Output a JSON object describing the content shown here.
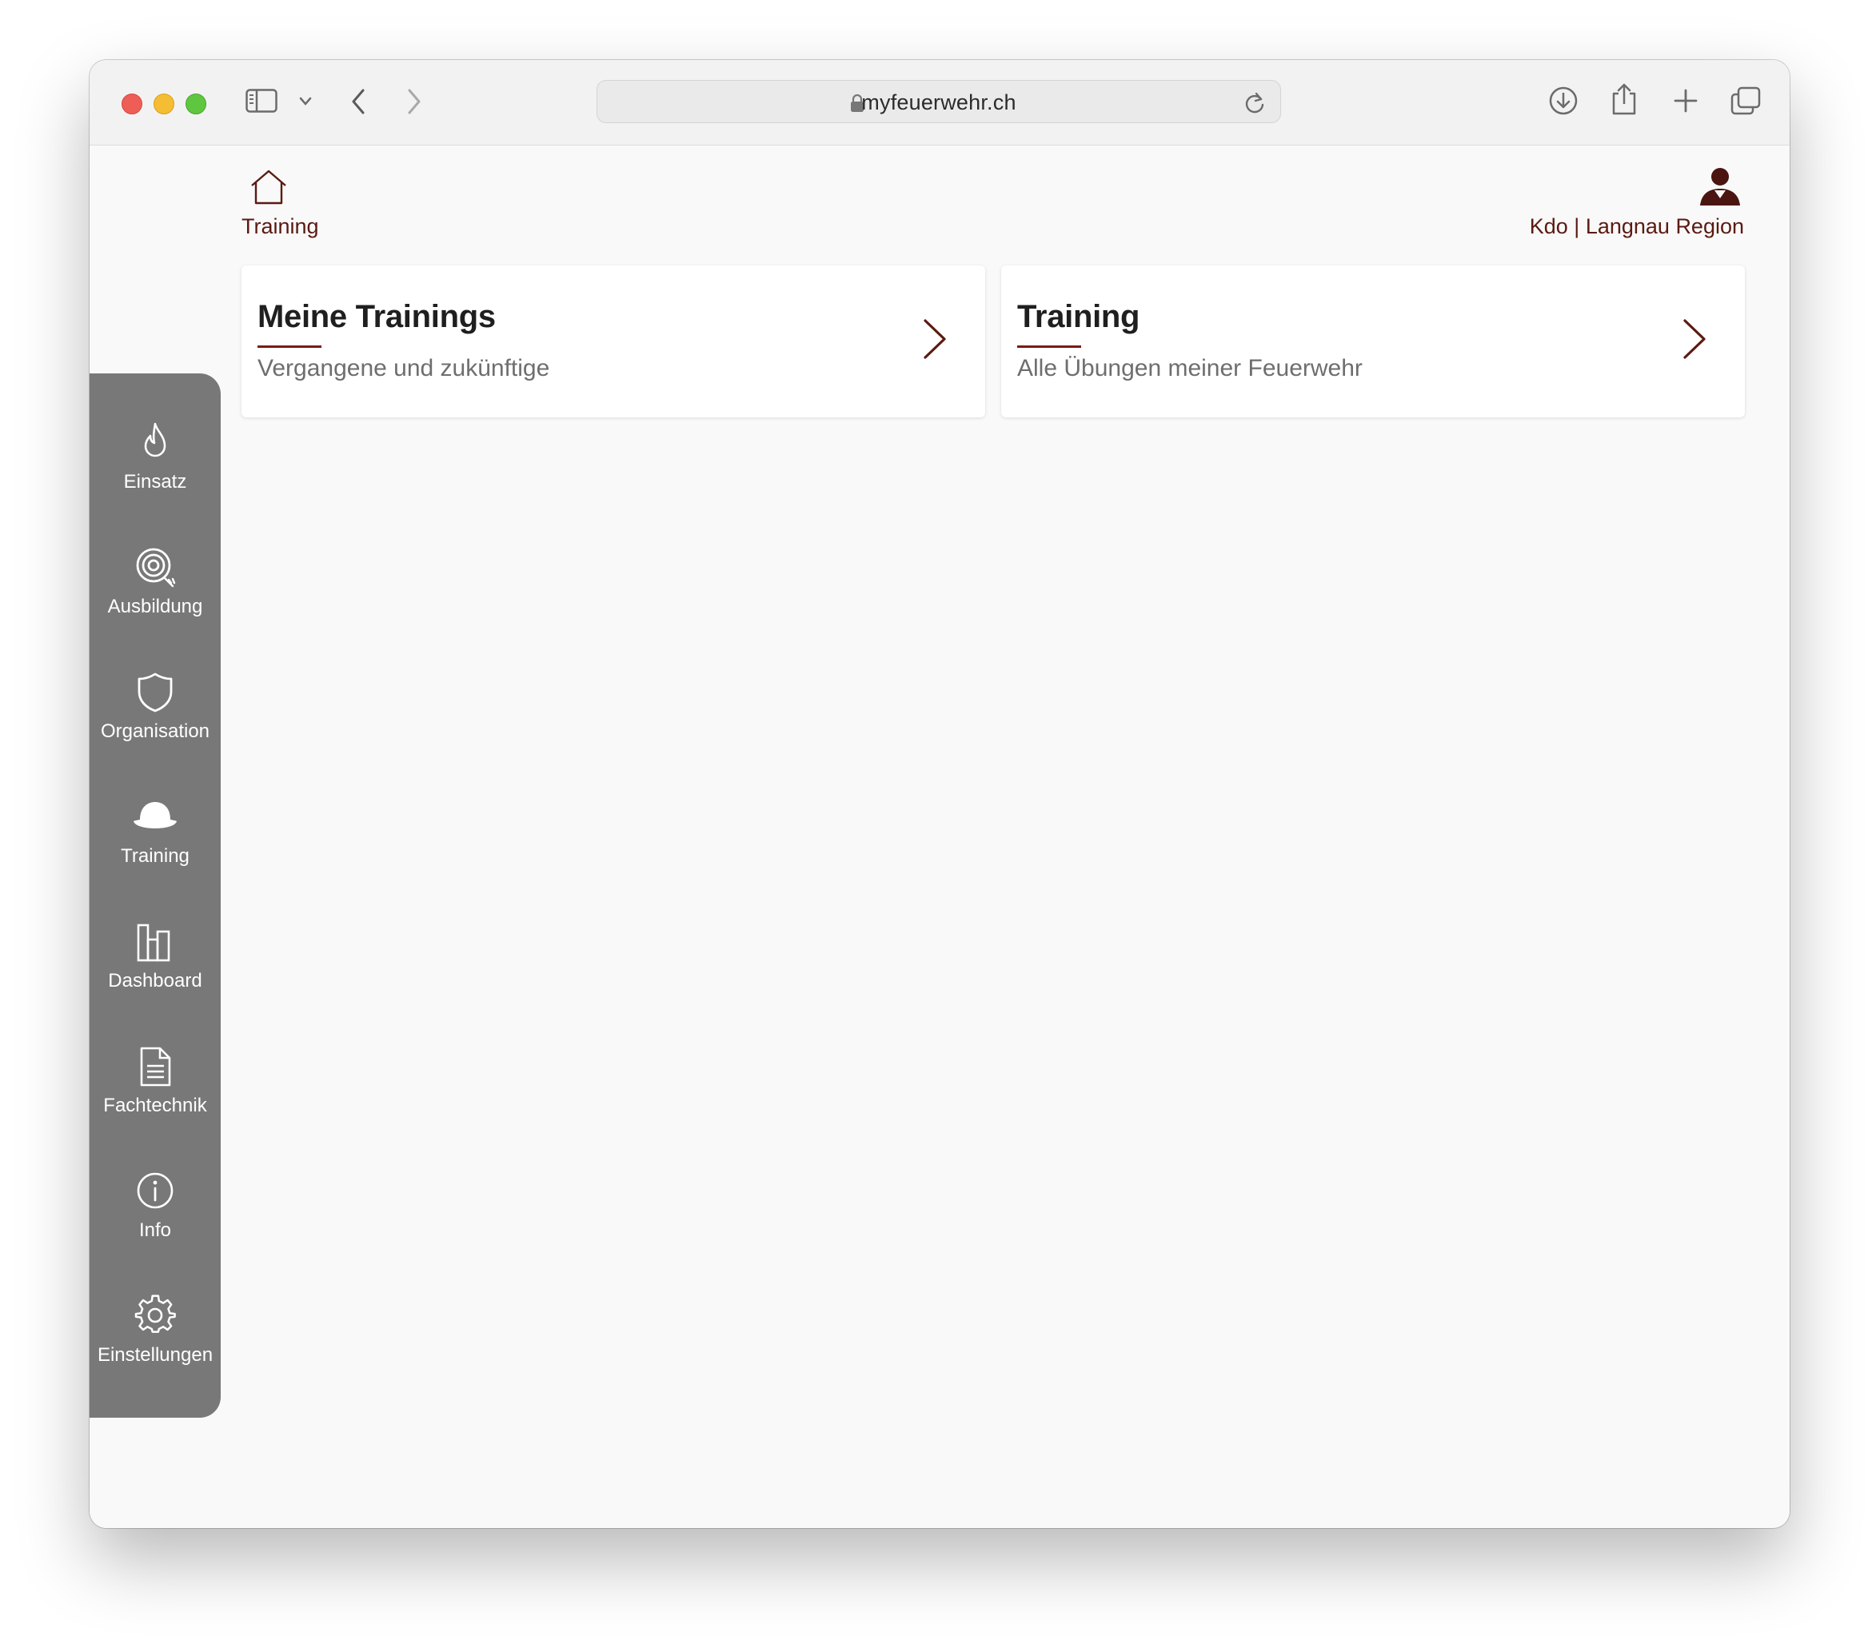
{
  "browser": {
    "url": "myfeuerwehr.ch"
  },
  "header": {
    "breadcrumb": "Training",
    "user_label": "Kdo | Langnau Region"
  },
  "cards": [
    {
      "title": "Meine Trainings",
      "subtitle": "Vergangene und zukünftige"
    },
    {
      "title": "Training",
      "subtitle": "Alle Übungen meiner Feuerwehr"
    }
  ],
  "sidebar": {
    "items": [
      {
        "label": "Einsatz",
        "icon": "flame-icon"
      },
      {
        "label": "Ausbildung",
        "icon": "hose-reel-icon"
      },
      {
        "label": "Organisation",
        "icon": "shield-icon"
      },
      {
        "label": "Training",
        "icon": "helmet-icon"
      },
      {
        "label": "Dashboard",
        "icon": "bar-chart-icon"
      },
      {
        "label": "Fachtechnik",
        "icon": "document-icon"
      },
      {
        "label": "Info",
        "icon": "info-icon"
      },
      {
        "label": "Einstellungen",
        "icon": "gear-icon"
      }
    ]
  },
  "colors": {
    "accent": "#7a1b12",
    "sidebar": "#787878",
    "background": "#f9f9f9"
  }
}
